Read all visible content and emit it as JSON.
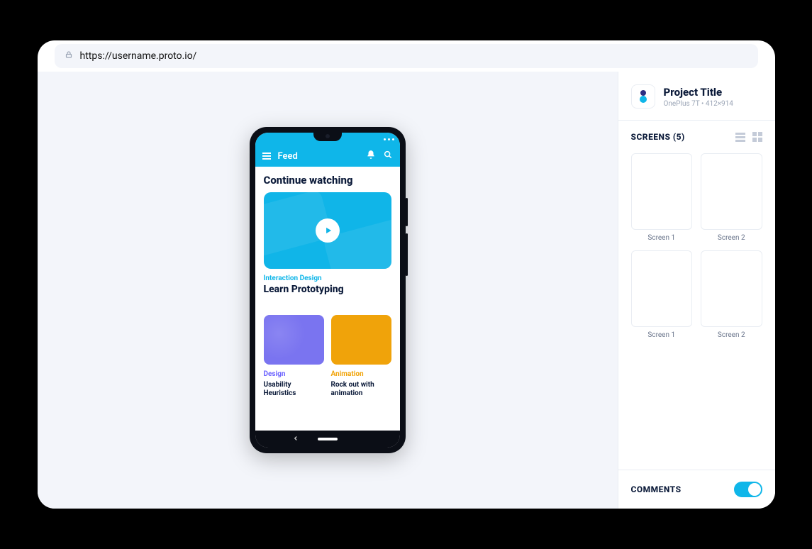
{
  "urlbar": {
    "url": "https://username.proto.io/"
  },
  "phone": {
    "appbar": {
      "title": "Feed"
    },
    "content": {
      "continue_watching_heading": "Continue watching",
      "hero": {
        "category": "Interaction Design",
        "title": "Learn Prototyping"
      },
      "cards": [
        {
          "category": "Design",
          "title": "Usability Heuristics"
        },
        {
          "category": "Animation",
          "title": "Rock out with animation"
        }
      ]
    }
  },
  "panel": {
    "project": {
      "title": "Project Title",
      "device": "OnePlus 7T",
      "dimensions": "412×914"
    },
    "screens": {
      "heading": "SCREENS (5)",
      "items": [
        {
          "label": "Screen 1"
        },
        {
          "label": "Screen 2"
        },
        {
          "label": "Screen 1"
        },
        {
          "label": "Screen 2"
        }
      ]
    },
    "comments": {
      "heading": "COMMENTS",
      "enabled": true
    }
  }
}
